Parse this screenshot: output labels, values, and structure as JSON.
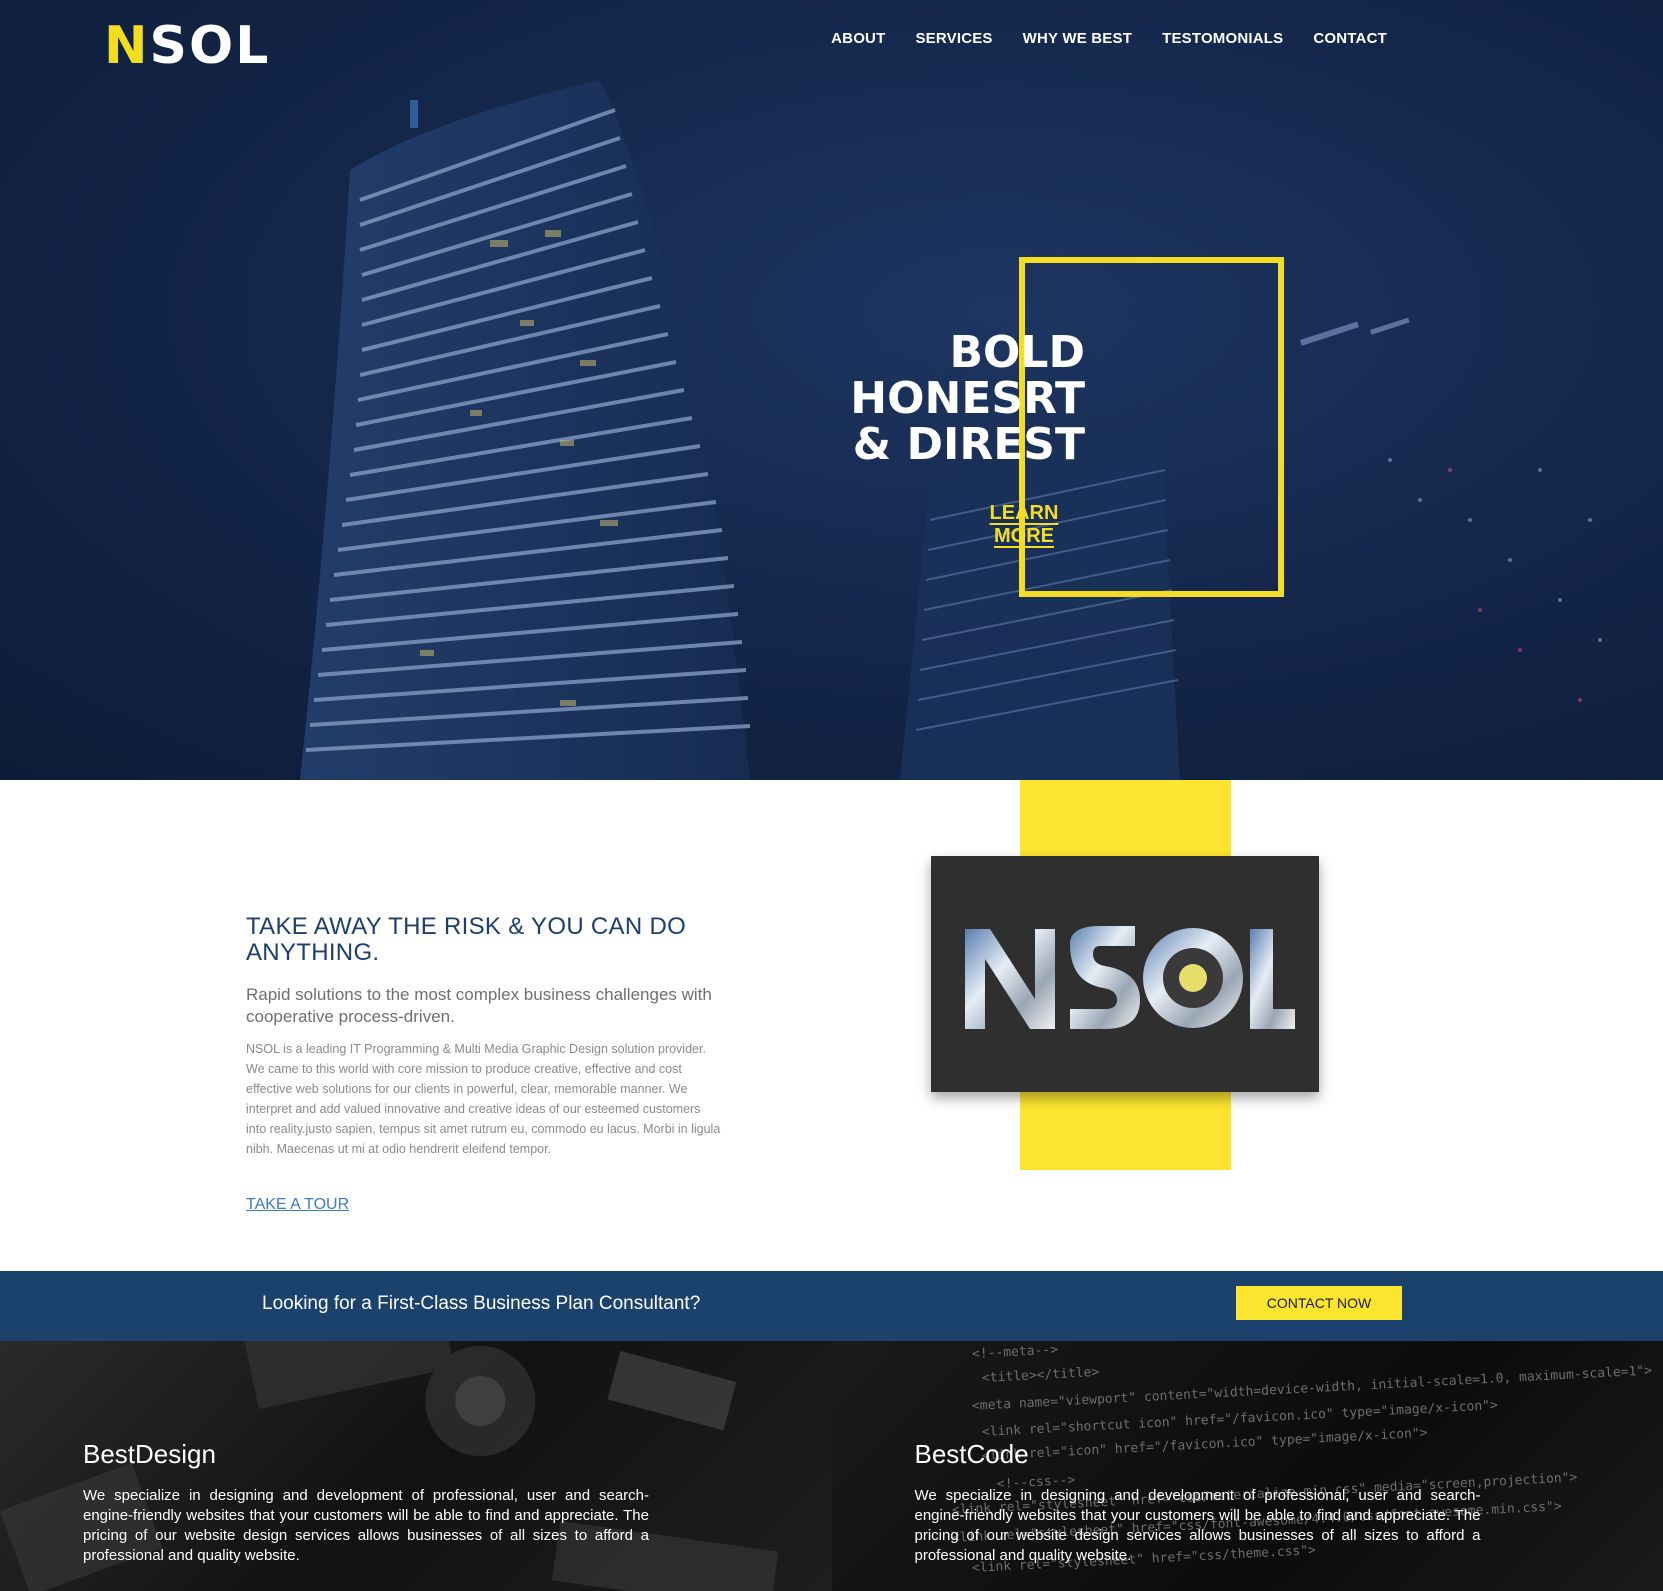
{
  "brand": {
    "logo_text": "NSOL"
  },
  "nav": {
    "items": [
      {
        "label": "ABOUT"
      },
      {
        "label": "SERVICES"
      },
      {
        "label": "WHY WE BEST"
      },
      {
        "label": "TESTOMONIALS"
      },
      {
        "label": "CONTACT"
      }
    ]
  },
  "hero": {
    "headline": [
      "BOLD",
      "HONESRT",
      "& DIREST"
    ],
    "cta_label": "LEARN MORE"
  },
  "about": {
    "title": "TAKE AWAY THE RISK & YOU CAN DO ANYTHING.",
    "subtitle": "Rapid solutions to the most complex business challenges with cooperative process-driven.",
    "body": "NSOL is a leading IT Programming & Multi Media Graphic Design solution provider. We came to this world with core mission to produce creative, effective and cost effective web solutions for our clients in powerful, clear, memorable manner. We interpret and add valued innovative and creative ideas of our esteemed customers into reality.justo sapien, tempus sit amet rutrum eu, commodo eu lacus. Morbi in ligula nibh. Maecenas ut mi at odio hendrerit eleifend tempor.",
    "link_label": "TAKE A TOUR",
    "card_logo_text": "NSOL"
  },
  "cta_bar": {
    "text": "Looking for a First-Class Business Plan Consultant?",
    "button_label": "CONTACT NOW"
  },
  "features": [
    {
      "title": "BestDesign",
      "text": "We specialize in designing and development of professional, user and search-engine-friendly websites that your customers will be able to find and appreciate. The pricing of our website design services allows businesses of all sizes to afford a professional and quality website."
    },
    {
      "title": "BestCode",
      "text": "We specialize in designing and development of professional, user and search-engine-friendly websites that your customers will be able to find and appreciate. The pricing of our website design services allows businesses of all sizes to afford a professional and quality website.",
      "code_lines": [
        "<!--meta-->",
        "<title></title>",
        "<meta name=\"viewport\" content=\"width=device-width, initial-scale=1.0, maximum-scale=1\">",
        "<link rel=\"shortcut icon\" href=\"/favicon.ico\" type=\"image/x-icon\">",
        "<link rel=\"icon\" href=\"/favicon.ico\" type=\"image/x-icon\">",
        "<!--css-->",
        "<link rel=\"stylesheet\" href=\"css/materialize.min.css\" media=\"screen,projection\">",
        "<link rel=\"stylesheet\" href=\"css/font-awesome/4.4.0/css/font-awesome.min.css\">",
        "<link rel=\"stylesheet\" href=\"css/theme.css\">"
      ]
    }
  ],
  "colors": {
    "accent_yellow": "#fbe52f",
    "navy": "#132548",
    "cta_blue": "#1b416d",
    "title_blue": "#1c3f6e",
    "link_blue": "#3d7cc4"
  }
}
